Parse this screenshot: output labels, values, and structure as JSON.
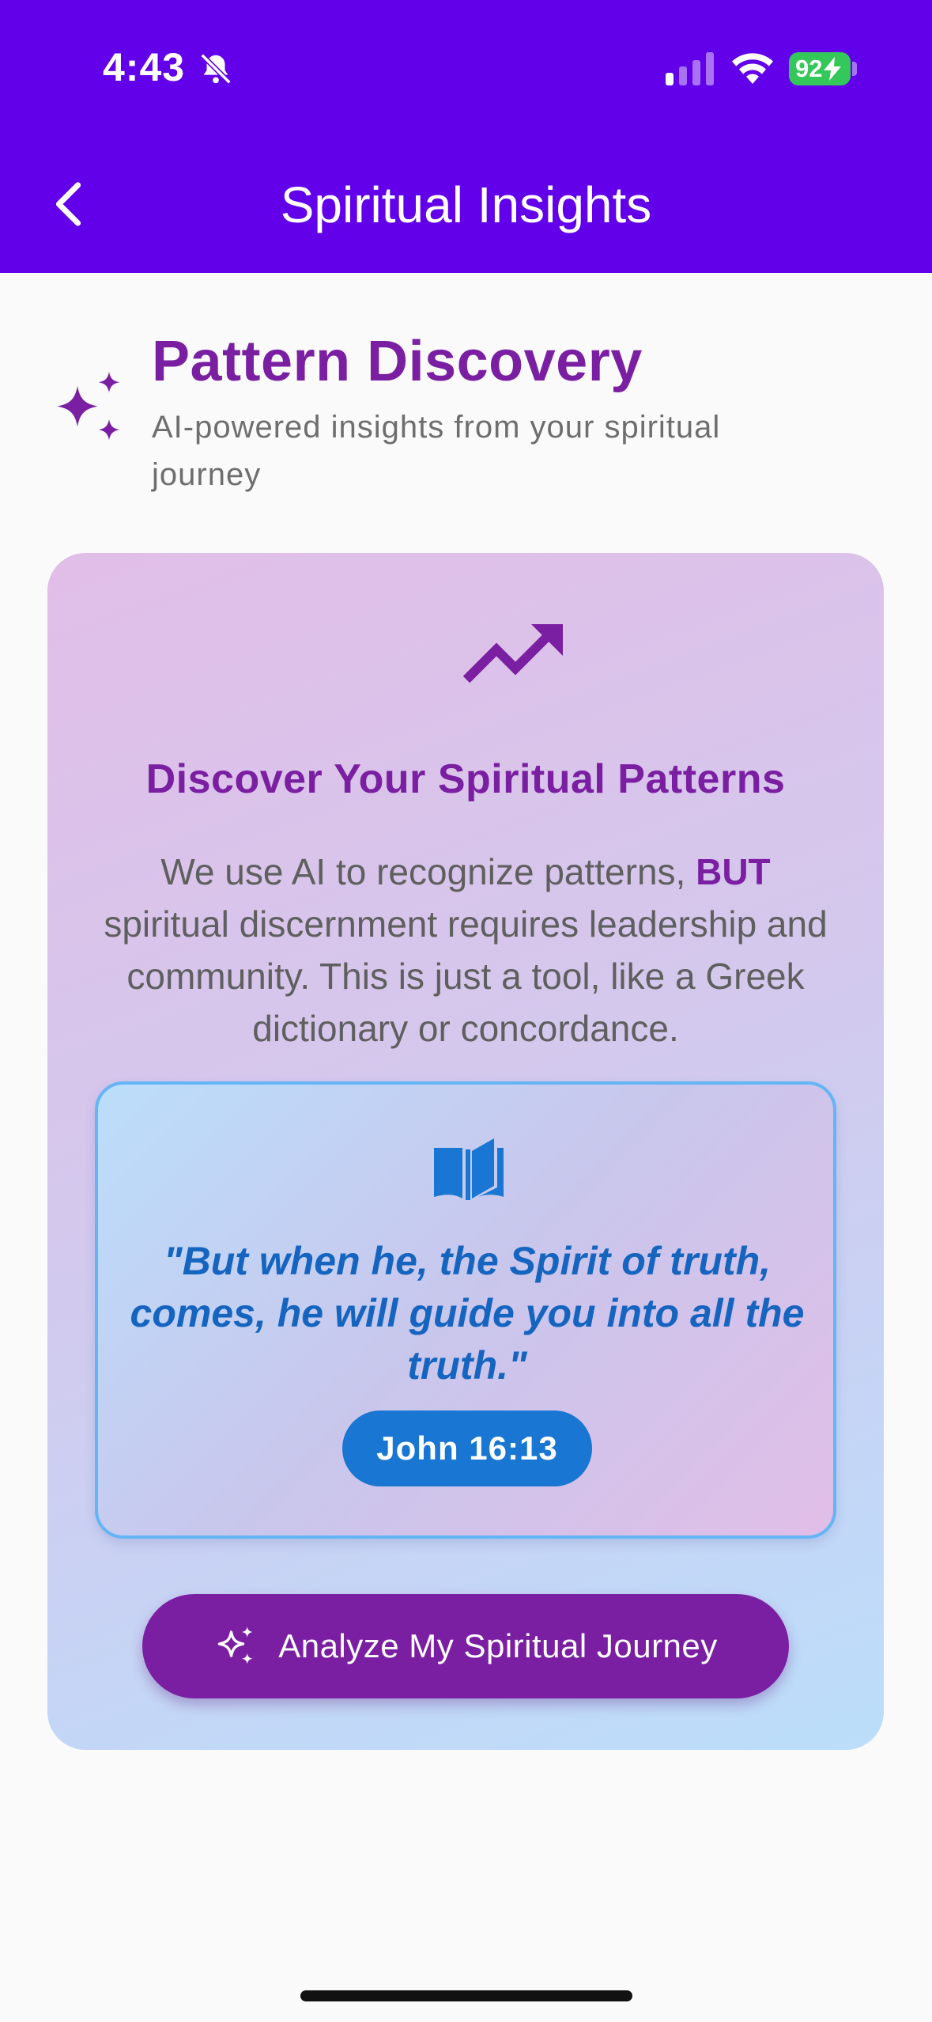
{
  "status_bar": {
    "time": "4:43",
    "battery": "92",
    "icons": [
      "bell-slash-icon",
      "signal-icon",
      "wifi-icon",
      "battery-icon"
    ]
  },
  "header": {
    "title": "Spiritual Insights",
    "back_icon": "chevron-left-icon"
  },
  "section": {
    "icon": "sparkles-icon",
    "title": "Pattern Discovery",
    "subtitle": "AI-powered insights from your spiritual journey"
  },
  "card": {
    "icon": "trending-up-icon",
    "heading": "Discover Your Spiritual Patterns",
    "body_part1": "We use AI to recognize patterns, ",
    "body_strong": "BUT",
    "body_part2": " spiritual discernment requires leadership and community. This is just a tool, like a Greek dictionary or concordance.",
    "verse": {
      "icon": "book-icon",
      "text": "\"But when he, the Spirit of truth, comes, he will guide you into all the truth.\"",
      "reference": "John 16:13"
    },
    "button": {
      "icon": "sparkles-icon",
      "label": "Analyze My Spiritual Journey"
    }
  },
  "colors": {
    "app_bar": "#6200EA",
    "accent_purple": "#7B1FA2",
    "verse_blue": "#1565C0",
    "reference_blue": "#1976D2",
    "battery_green": "#34C759"
  }
}
